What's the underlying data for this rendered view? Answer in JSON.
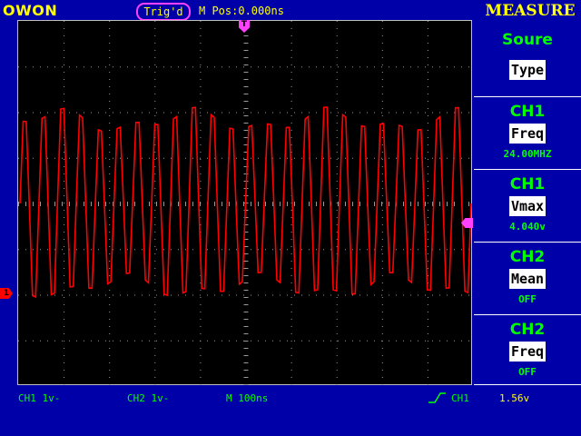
{
  "brand": "OWON",
  "header": {
    "trig_status": "Trig'd",
    "mpos": "M Pos:0.000ns",
    "menu_title": "MEASURE"
  },
  "markers": {
    "ch1": "1",
    "trigger_pos": "T"
  },
  "menu": [
    {
      "title": "Soure",
      "button": "Type",
      "value": ""
    },
    {
      "title": "CH1",
      "button": "Freq",
      "value": "24.00MHZ"
    },
    {
      "title": "CH1",
      "button": "Vmax",
      "value": "4.040v"
    },
    {
      "title": "CH2",
      "button": "Mean",
      "value": "OFF"
    },
    {
      "title": "CH2",
      "button": "Freq",
      "value": "OFF"
    }
  ],
  "status": {
    "ch1": "CH1 1v-",
    "ch2": "CH2 1v-",
    "timebase": "M 100ns",
    "trig_source": "CH1",
    "trig_level": "1.56v"
  },
  "colors": {
    "background": "#0000a8",
    "screen": "#000000",
    "trace": "#ff0000",
    "grid": "#9a9a9a",
    "accent": "#ffff00",
    "menu_text": "#00ff00",
    "marker": "#ff40ff"
  }
}
